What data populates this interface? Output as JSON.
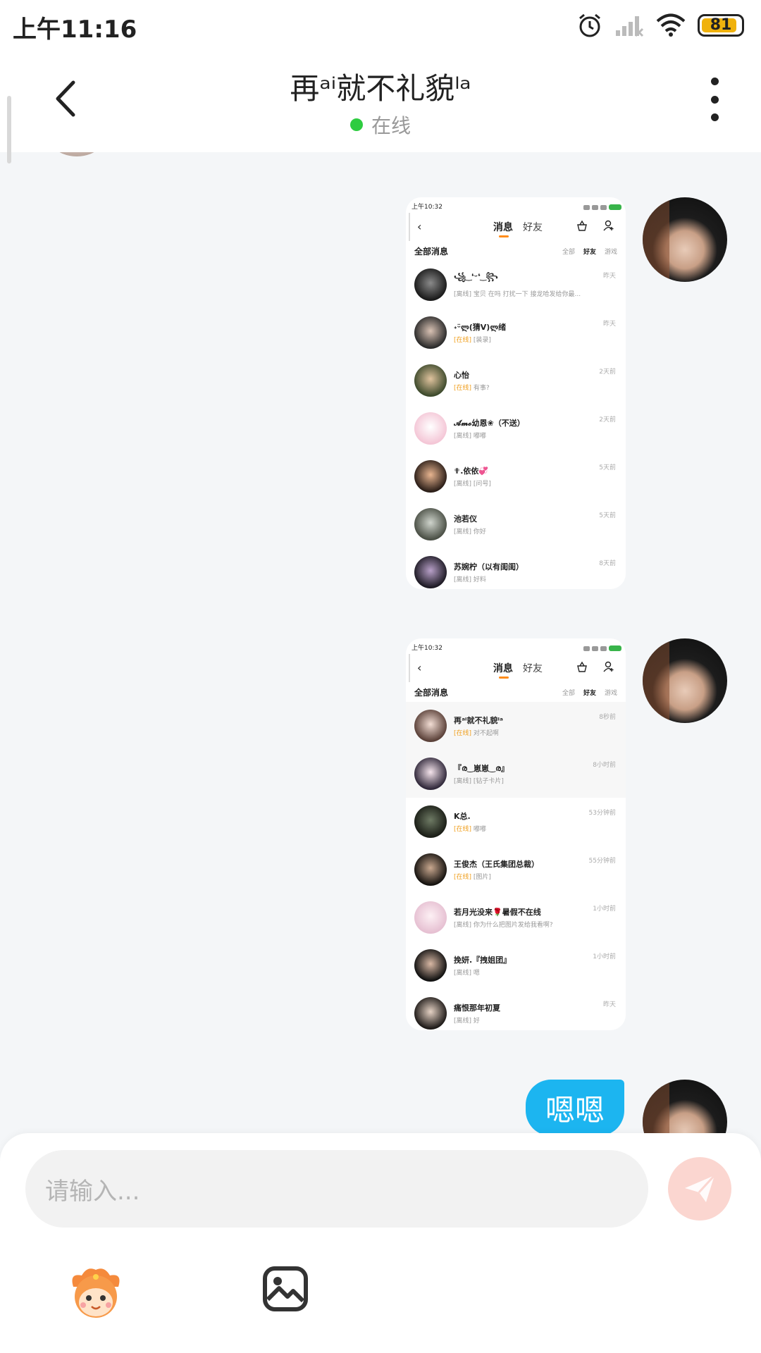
{
  "status_bar": {
    "time": "上午11:16",
    "battery": "81",
    "icons": [
      "alarm-icon",
      "signal-icon",
      "wifi-icon",
      "battery-icon"
    ]
  },
  "header": {
    "title": "再ᵃⁱ就不礼貌ˡᵃ",
    "status": "在线",
    "status_color": "#2ecc40",
    "icons": [
      "chevron-left-icon",
      "more-vertical-icon"
    ]
  },
  "messages": [
    {
      "type": "image",
      "screenshot": {
        "status_time": "上午10:32",
        "tabs": [
          "消息",
          "好友"
        ],
        "section_title": "全部消息",
        "filters": [
          "全部",
          "好友",
          "游戏"
        ],
        "rows": [
          {
            "name": "꧁ ͜ ❛ᵕ❛ ͜ ꧂",
            "status": "[离线]",
            "preview": "宝贝 在吗 打扰一下 接龙哈发给你最...",
            "time": "昨天"
          },
          {
            "name": "˖ᵕ̈ლ(猜V)ლ绪",
            "status": "[在线]",
            "preview": "[装录]",
            "time": "昨天"
          },
          {
            "name": "心怡",
            "status": "[在线]",
            "preview": "有事?",
            "time": "2天前"
          },
          {
            "name": "𝓐𝓶𝓸幼恩❀（不送）",
            "status": "[离线]",
            "preview": "嘟嘟",
            "time": "2天前"
          },
          {
            "name": "✟.依依💞",
            "status": "[离线]",
            "preview": "[问号]",
            "time": "5天前"
          },
          {
            "name": "池若仪",
            "status": "[离线]",
            "preview": "你好",
            "time": "5天前"
          },
          {
            "name": "苏婉柠（以有闺闺）",
            "status": "[离线]",
            "preview": "好料",
            "time": "8天前"
          }
        ]
      }
    },
    {
      "type": "image",
      "screenshot": {
        "status_time": "上午10:32",
        "tabs": [
          "消息",
          "好友"
        ],
        "section_title": "全部消息",
        "filters": [
          "全部",
          "好友",
          "游戏"
        ],
        "rows": [
          {
            "name": "再ᵃⁱ就不礼貌ˡᵃ",
            "status": "[在线]",
            "preview": "对不起啊",
            "time": "8秒前"
          },
          {
            "name": "『ര‿崽崽‿ര』",
            "status": "[离线]",
            "preview": "[钻子卡片]",
            "time": "8小时前"
          },
          {
            "name": "K总.",
            "status": "[在线]",
            "preview": "嘟嘟",
            "time": "53分钟前"
          },
          {
            "name": "王俊杰（王氏集团总裁）",
            "status": "[在线]",
            "preview": "[图片]",
            "time": "55分钟前"
          },
          {
            "name": "若月光没来🌹暑假不在线",
            "status": "[离线]",
            "preview": "你为什么把图片发给我看啊?",
            "time": "1小时前"
          },
          {
            "name": "挽妍.『拽姐团』",
            "status": "[离线]",
            "preview": "嗯",
            "time": "1小时前"
          },
          {
            "name": "痛恨那年初夏",
            "status": "[离线]",
            "preview": "好",
            "time": "昨天"
          }
        ]
      }
    },
    {
      "type": "text",
      "text": "嗯嗯",
      "bubble_color": "#1cb5f0"
    }
  ],
  "input": {
    "placeholder": "请输入...",
    "icons": [
      "send-icon",
      "emoji-mascot-icon",
      "image-icon"
    ],
    "send_color": "#fbd6d0"
  }
}
